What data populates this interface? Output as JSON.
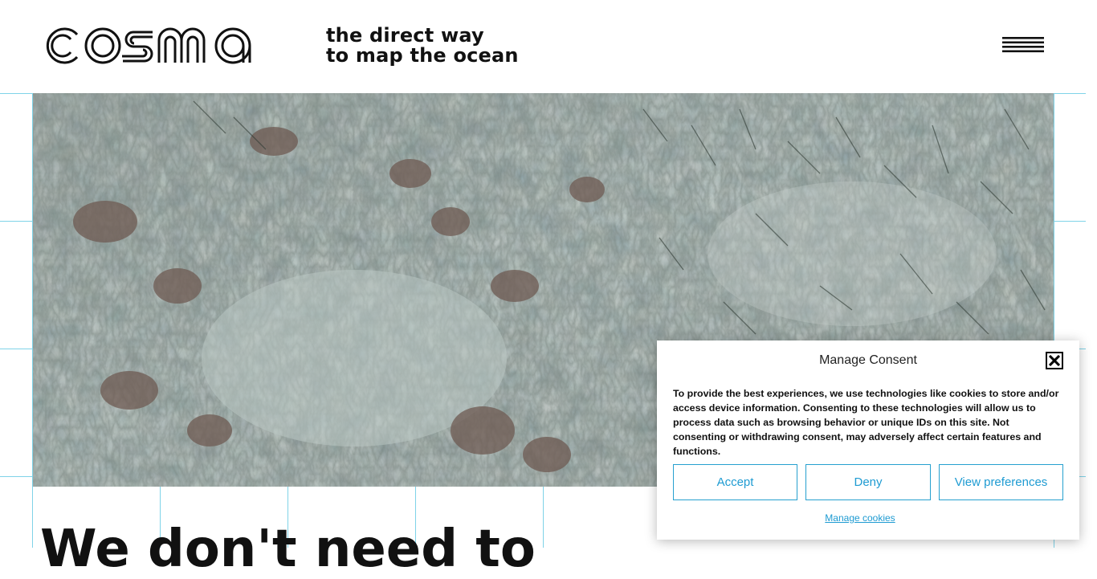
{
  "brand": {
    "logo_text": "cosma"
  },
  "header": {
    "tagline_line1": "the direct way",
    "tagline_line2": "to map the ocean",
    "menu_icon": "hamburger-menu-icon"
  },
  "hero": {
    "image_description_icon": "seabed-aerial-photo"
  },
  "main": {
    "heading_partial": "We don't need to"
  },
  "consent": {
    "title": "Manage Consent",
    "body": "To provide the best experiences, we use technologies like cookies to store and/or access device information. Consenting to these technologies will allow us to process data such as browsing behavior or unique IDs on this site. Not consenting or withdrawing consent, may adversely affect certain features and functions.",
    "accept_label": "Accept",
    "deny_label": "Deny",
    "preferences_label": "View preferences",
    "manage_link": "Manage cookies",
    "close_icon": "close-icon"
  },
  "colors": {
    "accent": "#1e9bd2",
    "grid_line": "#7fd3e8",
    "text": "#111111"
  }
}
